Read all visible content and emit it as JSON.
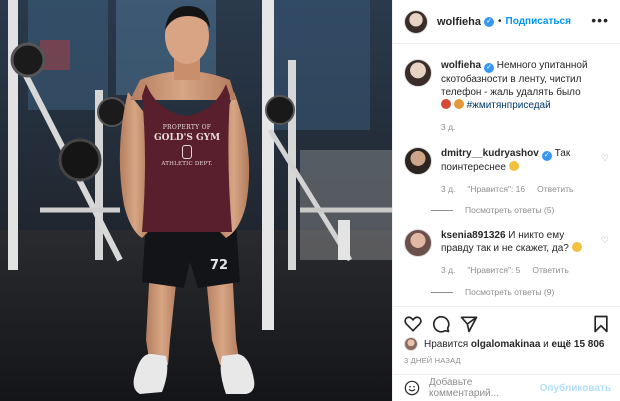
{
  "header": {
    "username": "wolfieha",
    "follow_label": "Подписаться",
    "separator": "•"
  },
  "caption": {
    "username": "wolfieha",
    "text": "Немного упитанной скотобазности в ленту, чистил телефон - жаль удалять было",
    "hashtag": "#жмитянприседай",
    "time": "3 д."
  },
  "comments": [
    {
      "username": "dmitry__kudryashov",
      "text": "Так поинтереснее",
      "time": "3 д.",
      "likes_label": "\"Нравится\": 16",
      "reply_label": "Ответить",
      "view_replies": "Посмотреть ответы (5)"
    },
    {
      "username": "ksenia891326",
      "text": "И никто ему правду так и не скажет, да?",
      "time": "3 д.",
      "likes_label": "\"Нравится\": 5",
      "reply_label": "Ответить",
      "view_replies": "Посмотреть ответы (9)"
    }
  ],
  "likes": {
    "prefix": "Нравится",
    "user": "olgalomakinaa",
    "middle": "и",
    "rest": "ещё 15 806"
  },
  "time_ago": "3 ДНЕЙ НАЗАД",
  "add_comment": {
    "placeholder": "Добавьте комментарий...",
    "post_label": "Опубликовать"
  },
  "shirt": {
    "line1": "PROPERTY OF",
    "line2": "GOLD'S GYM",
    "line3": "ATHLETIC DEPT.",
    "shorts_number": "72"
  },
  "colors": {
    "link_blue": "#0095f6",
    "verified_blue": "#3897f0",
    "text": "#262626",
    "muted": "#8e8e8e",
    "tank_top": "#5a1f2c"
  },
  "icons": [
    "more-icon",
    "heart-icon",
    "comment-icon",
    "share-icon",
    "bookmark-icon",
    "smile-icon",
    "verified-icon"
  ]
}
